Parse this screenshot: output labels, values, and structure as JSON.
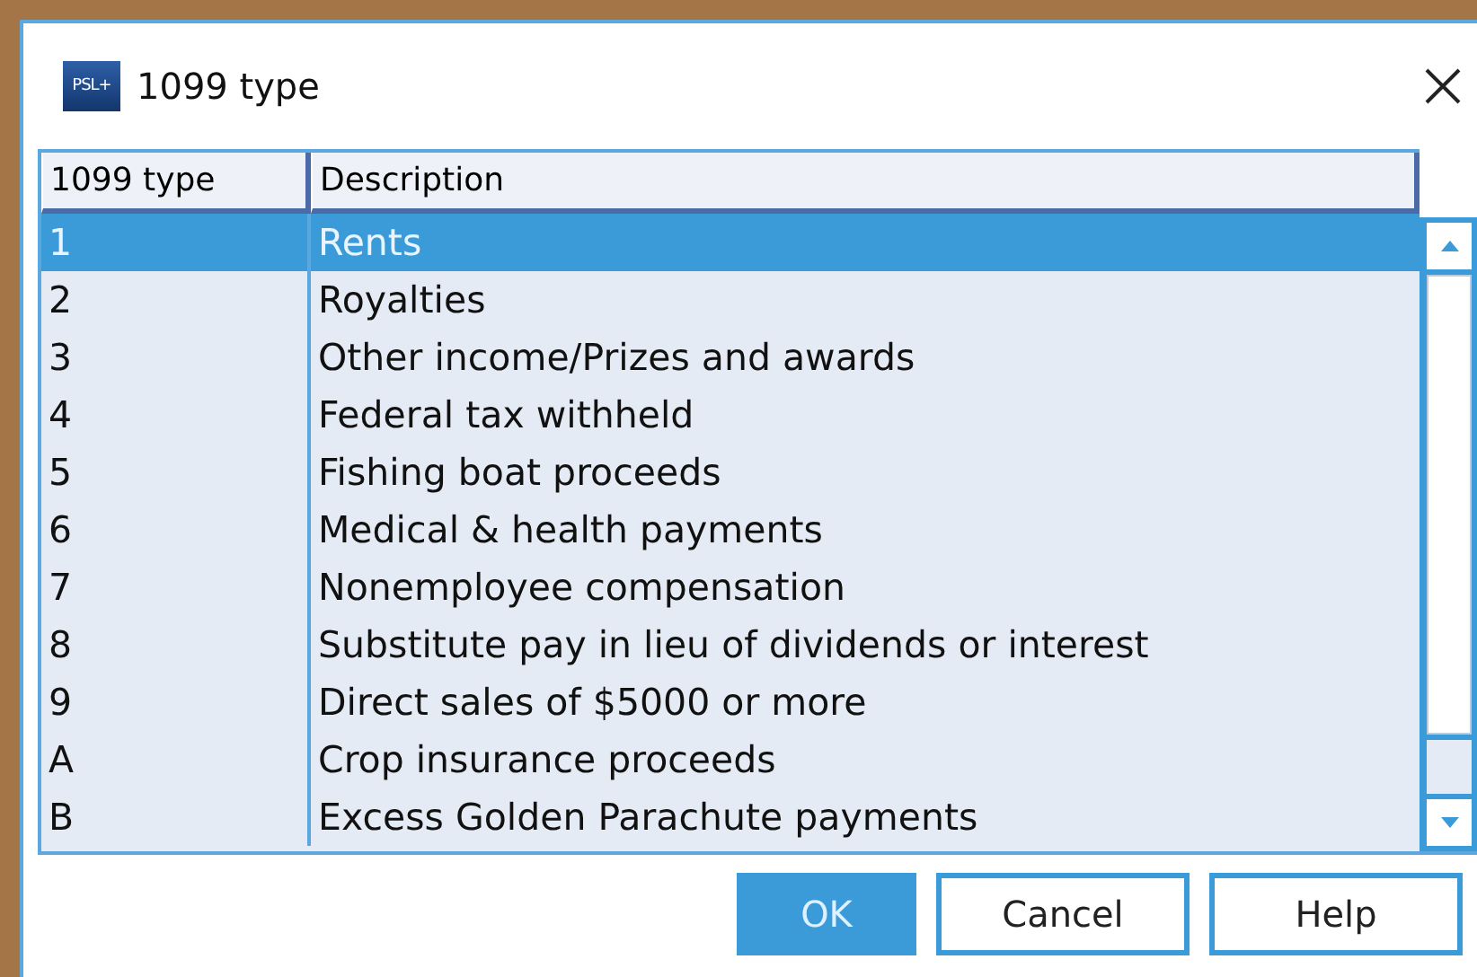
{
  "window": {
    "title": "1099 type",
    "logo_text": "PSL+"
  },
  "table": {
    "columns": [
      "1099 type",
      "Description"
    ],
    "rows": [
      {
        "cells": [
          "1",
          "Rents"
        ],
        "selected": true
      },
      {
        "cells": [
          "2",
          "Royalties"
        ],
        "selected": false
      },
      {
        "cells": [
          "3",
          "Other income/Prizes and awards"
        ],
        "selected": false
      },
      {
        "cells": [
          "4",
          "Federal tax withheld"
        ],
        "selected": false
      },
      {
        "cells": [
          "5",
          "Fishing boat proceeds"
        ],
        "selected": false
      },
      {
        "cells": [
          "6",
          "Medical & health payments"
        ],
        "selected": false
      },
      {
        "cells": [
          "7",
          "Nonemployee compensation"
        ],
        "selected": false
      },
      {
        "cells": [
          "8",
          "Substitute pay in lieu of dividends or interest"
        ],
        "selected": false
      },
      {
        "cells": [
          "9",
          "Direct sales of $5000 or more"
        ],
        "selected": false
      },
      {
        "cells": [
          "A",
          "Crop insurance proceeds"
        ],
        "selected": false
      },
      {
        "cells": [
          "B",
          "Excess Golden Parachute payments"
        ],
        "selected": false
      }
    ]
  },
  "buttons": [
    {
      "label": "OK",
      "kind": "primary"
    },
    {
      "label": "Cancel",
      "kind": "normal"
    },
    {
      "label": "Help",
      "kind": "normal"
    }
  ]
}
